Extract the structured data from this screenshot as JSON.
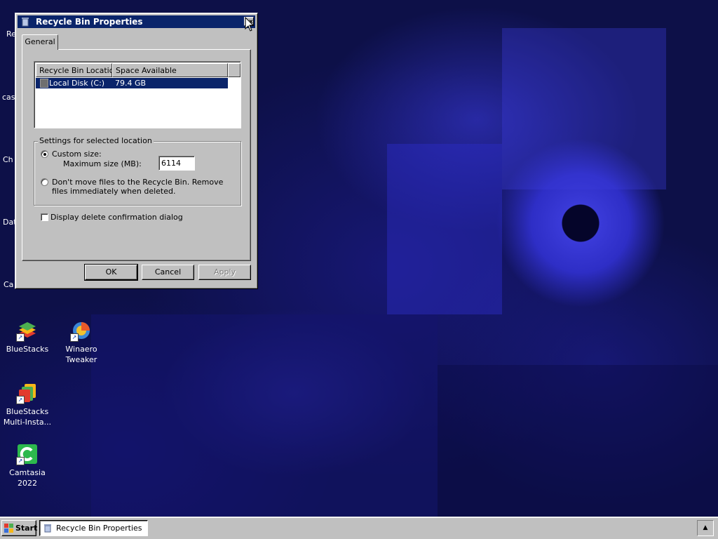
{
  "dialog": {
    "title": "Recycle Bin Properties",
    "close_glyph": "×",
    "tabs": [
      {
        "label": "General",
        "selected": true
      }
    ],
    "location_list": {
      "columns": [
        "Recycle Bin Location",
        "Space Available"
      ],
      "rows": [
        {
          "location": "Local Disk (C:)",
          "space": "79.4 GB",
          "selected": true
        }
      ]
    },
    "settings_group": {
      "title": "Settings for selected location",
      "custom_size_label": "Custom size:",
      "custom_size_selected": true,
      "max_size_label": "Maximum size (MB):",
      "max_size_value": "6114",
      "dont_move_label": "Don't move files to the Recycle Bin. Remove files immediately when deleted.",
      "dont_move_selected": false
    },
    "confirm_checkbox": {
      "label": "Display delete confirmation dialog",
      "checked": false
    },
    "buttons": {
      "ok": "OK",
      "cancel": "Cancel",
      "apply": "Apply"
    }
  },
  "desktop": {
    "clipped_labels": [
      "Re",
      "cas",
      "Ch",
      "Dat",
      "Ca"
    ],
    "icons": [
      {
        "line1": "BlueStacks",
        "line2": "",
        "icon": "bluestacks-icon"
      },
      {
        "line1": "Winaero",
        "line2": "Tweaker",
        "icon": "winaero-tweaker-icon"
      },
      {
        "line1": "BlueStacks",
        "line2": "Multi-Insta...",
        "icon": "bluestacks-multi-instance-icon"
      },
      {
        "line1": "Camtasia",
        "line2": "2022",
        "icon": "camtasia-icon"
      }
    ]
  },
  "taskbar": {
    "start_label": "Start",
    "tasks": [
      {
        "label": "Recycle Bin Properties",
        "icon": "recycle-bin-icon",
        "active": true
      }
    ],
    "tray_arrow_glyph": "▲"
  },
  "colors": {
    "titlebar": "#0a246a",
    "face": "#c0c0c0",
    "selection": "#0a246a",
    "wallpaper_base": "#0d1048"
  }
}
